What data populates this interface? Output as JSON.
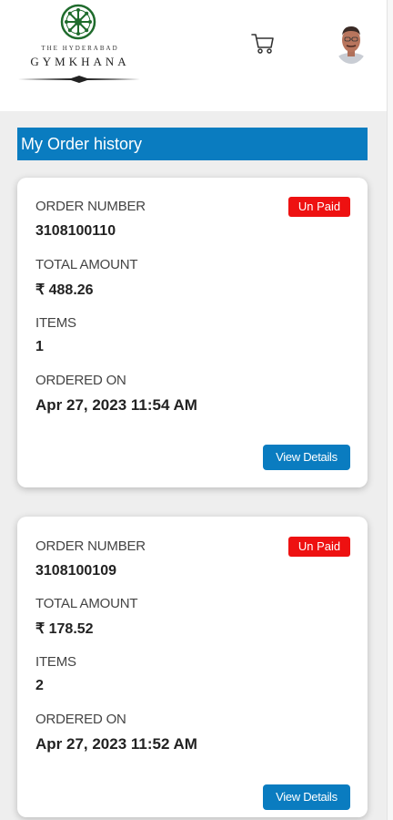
{
  "header": {
    "logo_small": "THE HYDERABAD",
    "logo_big": "GYMKHANA"
  },
  "page_title": "My Order history",
  "orders": [
    {
      "order_number_label": "ORDER NUMBER",
      "order_number": "3108100110",
      "status": "Un Paid",
      "total_label": "TOTAL AMOUNT",
      "total": "₹ 488.26",
      "items_label": "ITEMS",
      "items": "1",
      "ordered_on_label": "ORDERED ON",
      "ordered_on": "Apr 27, 2023 11:54 AM",
      "button": "View Details"
    },
    {
      "order_number_label": "ORDER NUMBER",
      "order_number": "3108100109",
      "status": "Un Paid",
      "total_label": "TOTAL AMOUNT",
      "total": "₹ 178.52",
      "items_label": "ITEMS",
      "items": "2",
      "ordered_on_label": "ORDERED ON",
      "ordered_on": "Apr 27, 2023 11:52 AM",
      "button": "View Details"
    }
  ],
  "colors": {
    "accent": "#0a7cc0",
    "status_unpaid": "#ee1111",
    "logo_green": "#1f6b2c"
  },
  "icons": [
    "logo-emblem-icon",
    "cart-icon",
    "user-avatar"
  ]
}
